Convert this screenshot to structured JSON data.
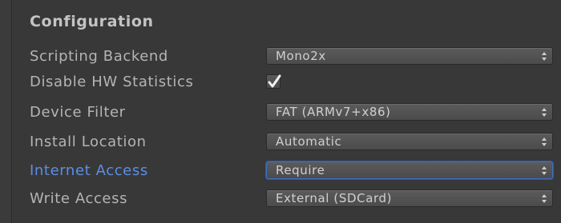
{
  "section": {
    "title": "Configuration"
  },
  "rows": [
    {
      "label": "Scripting Backend",
      "control": "dropdown",
      "value": "Mono2x"
    },
    {
      "label": "Disable HW Statistics",
      "control": "checkbox",
      "checked": true
    },
    {
      "label": "Device Filter",
      "control": "dropdown",
      "value": "FAT (ARMv7+x86)"
    },
    {
      "label": "Install Location",
      "control": "dropdown",
      "value": "Automatic"
    },
    {
      "label": "Internet Access",
      "control": "dropdown",
      "value": "Require",
      "focused": true
    },
    {
      "label": "Write Access",
      "control": "dropdown",
      "value": "External (SDCard)"
    }
  ],
  "colors": {
    "background": "#383838",
    "label": "#b4b4b4",
    "focused_label": "#5a8ee6",
    "focus_ring": "#3e6fc2"
  },
  "icons": {
    "dropdown_arrows": "up-down-arrows-icon",
    "checkmark": "checkmark-icon"
  }
}
